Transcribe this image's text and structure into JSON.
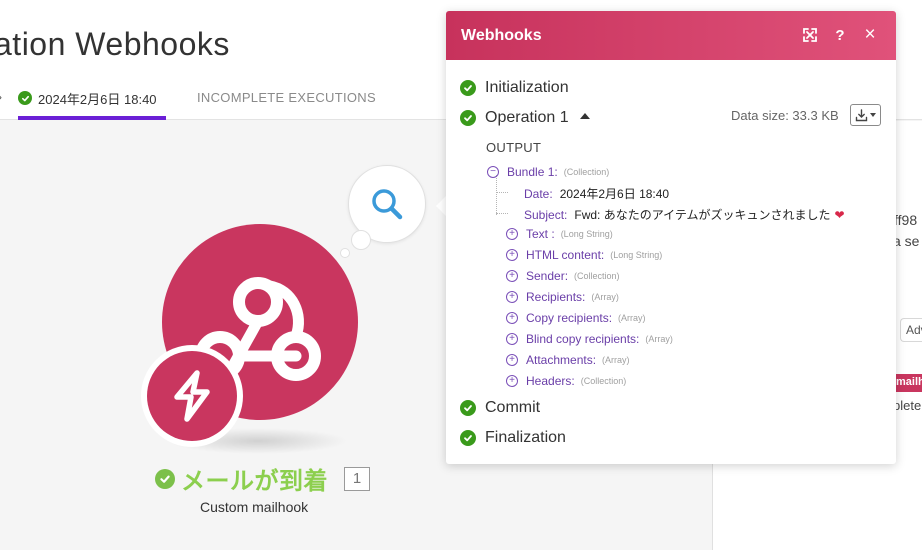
{
  "header": {
    "title": "ation Webhooks",
    "tabs": [
      {
        "label": "2024年2月6日 18:40",
        "active": true
      },
      {
        "label": "INCOMPLETE EXECUTIONS",
        "active": false
      }
    ]
  },
  "canvas": {
    "module_name": "メールが到着",
    "module_count": "1",
    "module_subtitle": "Custom mailhook",
    "search_icon": "search-icon",
    "module_icon": "webhook-icon",
    "trigger_icon": "lightning-icon"
  },
  "right_panel": {
    "fragment_1": "ff98",
    "fragment_2": "a se",
    "adv_button": "Adv",
    "tag": "mailh",
    "fragment_3": "plete"
  },
  "popup": {
    "title": "Webhooks",
    "buttons": {
      "expand": "expand-icon",
      "help": "?",
      "close": "×"
    },
    "steps": [
      {
        "label": "Initialization"
      },
      {
        "label": "Operation 1"
      },
      {
        "label": "Commit"
      },
      {
        "label": "Finalization"
      }
    ],
    "data_size": "Data size: 33.3 KB",
    "output_label": "OUTPUT",
    "bundle": {
      "key": "Bundle 1:",
      "type": "(Collection)",
      "date_key": "Date:",
      "date_value": "2024年2月6日 18:40",
      "subject_key": "Subject:",
      "subject_value": "Fwd: あなたのアイテムがズッキュンされました",
      "children": [
        {
          "key": "Text :",
          "type": "(Long String)"
        },
        {
          "key": "HTML content:",
          "type": "(Long String)"
        },
        {
          "key": "Sender:",
          "type": "(Collection)"
        },
        {
          "key": "Recipients:",
          "type": "(Array)"
        },
        {
          "key": "Copy recipients:",
          "type": "(Array)"
        },
        {
          "key": "Blind copy recipients:",
          "type": "(Array)"
        },
        {
          "key": "Attachments:",
          "type": "(Array)"
        },
        {
          "key": "Headers:",
          "type": "(Collection)"
        }
      ]
    }
  },
  "colors": {
    "brand": "#c9365f",
    "success": "#3a9a1b",
    "tab_underline": "#6b1fd6",
    "module_name": "#8ccf4e"
  }
}
